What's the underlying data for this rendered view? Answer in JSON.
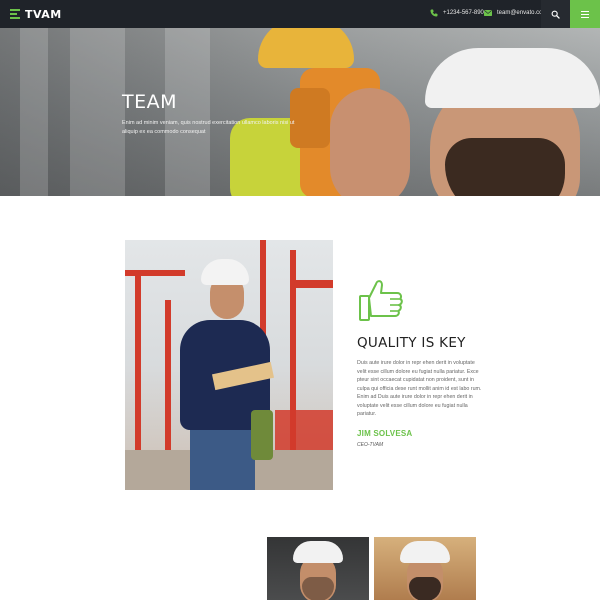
{
  "header": {
    "logo_text": "TVAM",
    "phone": "+1234-567-890",
    "email": "team@envato.com",
    "icons": {
      "logo": "menu-lines-icon",
      "phone": "phone-icon",
      "email": "envelope-icon",
      "search": "search-icon",
      "menu": "hamburger-icon"
    },
    "colors": {
      "bar": "#1f2329",
      "accent": "#6cc24a"
    }
  },
  "hero": {
    "title": "TEAM",
    "subtitle": "Enim ad minim veniam, quis nostrud exercitation ullamco laboris nisi ut aliquip ex ea commodo consequat"
  },
  "quality": {
    "icon": "thumbs-up-icon",
    "title": "QUALITY IS KEY",
    "body": "Duis aute irure dolor in repr ehen derit in voluptate velit esse cillum dolore eu fugiat nulla pariatur. Exce pteur sint occaecat cupidatat non proident, sunt in culpa qui officia dese runt mollit anim id est labo rum. Enim ad  Duis aute irure dolor in repr ehen derit in voluptate velit esse cillum dolore eu fugiat nulla pariatur.",
    "name": "JIM SOLVESA",
    "role": "CEO-TVAM"
  }
}
